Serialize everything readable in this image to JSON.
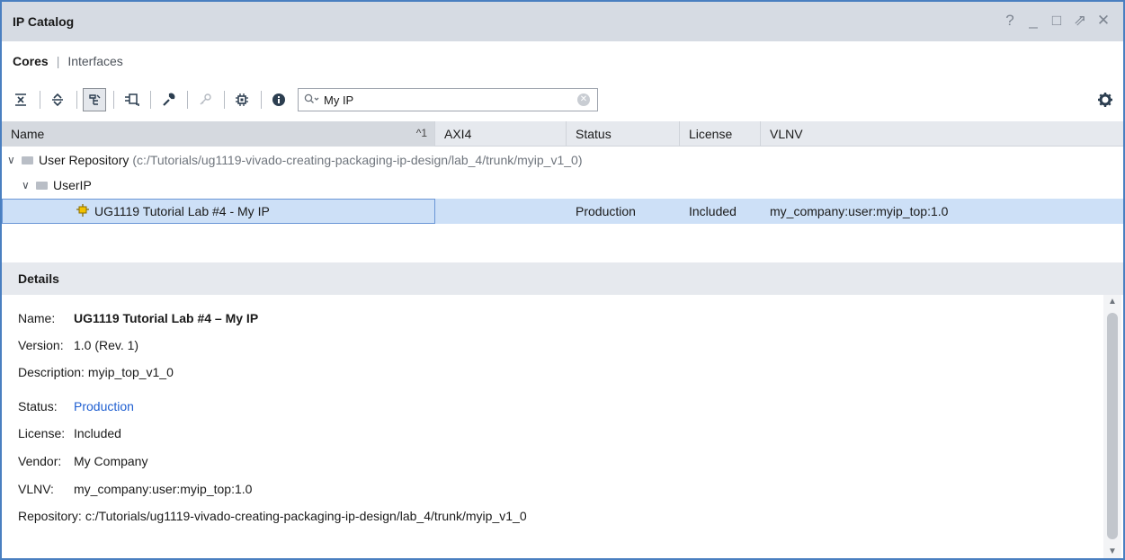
{
  "window": {
    "title": "IP Catalog",
    "controls": [
      "?",
      "_",
      "□",
      "⇗",
      "✕"
    ]
  },
  "subtabs": {
    "cores": "Cores",
    "separator": "|",
    "interfaces": "Interfaces"
  },
  "toolbar": {
    "search_value": "My IP",
    "search_placeholder": "Search",
    "icons": [
      "collapse-all-icon",
      "expand-all-icon",
      "hierarchy-filter-icon",
      "customize-ip-icon",
      "wrench-icon",
      "key-icon",
      "chip-icon",
      "info-icon",
      "search-icon",
      "clear-icon",
      "gear-icon"
    ]
  },
  "table": {
    "columns": [
      "Name",
      "AXI4",
      "Status",
      "License",
      "VLNV"
    ],
    "sort_indicator": "^1",
    "repo_label": "User Repository",
    "repo_path": "(c:/Tutorials/ug1119-vivado-creating-packaging-ip-design/lab_4/trunk/myip_v1_0)",
    "group_label": "UserIP",
    "ip_row": {
      "name": "UG1119 Tutorial Lab #4 - My IP",
      "axi4": "",
      "status": "Production",
      "license": "Included",
      "vlnv": "my_company:user:myip_top:1.0"
    }
  },
  "details": {
    "title": "Details",
    "fields": {
      "name_label": "Name:",
      "name_value": "UG1119 Tutorial Lab #4 – My IP",
      "version_label": "Version:",
      "version_value": "1.0 (Rev. 1)",
      "description_label": "Description:",
      "description_value": "myip_top_v1_0",
      "status_label": "Status:",
      "status_value": "Production",
      "license_label": "License:",
      "license_value": "Included",
      "vendor_label": "Vendor:",
      "vendor_value": "My Company",
      "vlnv_label": "VLNV:",
      "vlnv_value": "my_company:user:myip_top:1.0",
      "repository_label": "Repository:",
      "repository_value": "c:/Tutorials/ug1119-vivado-creating-packaging-ip-design/lab_4/trunk/myip_v1_0"
    }
  },
  "colors": {
    "accent_border": "#4a7fc0",
    "selection": "#cde0f7",
    "link": "#1f5fd1",
    "header_bg": "#e6e9ee"
  }
}
